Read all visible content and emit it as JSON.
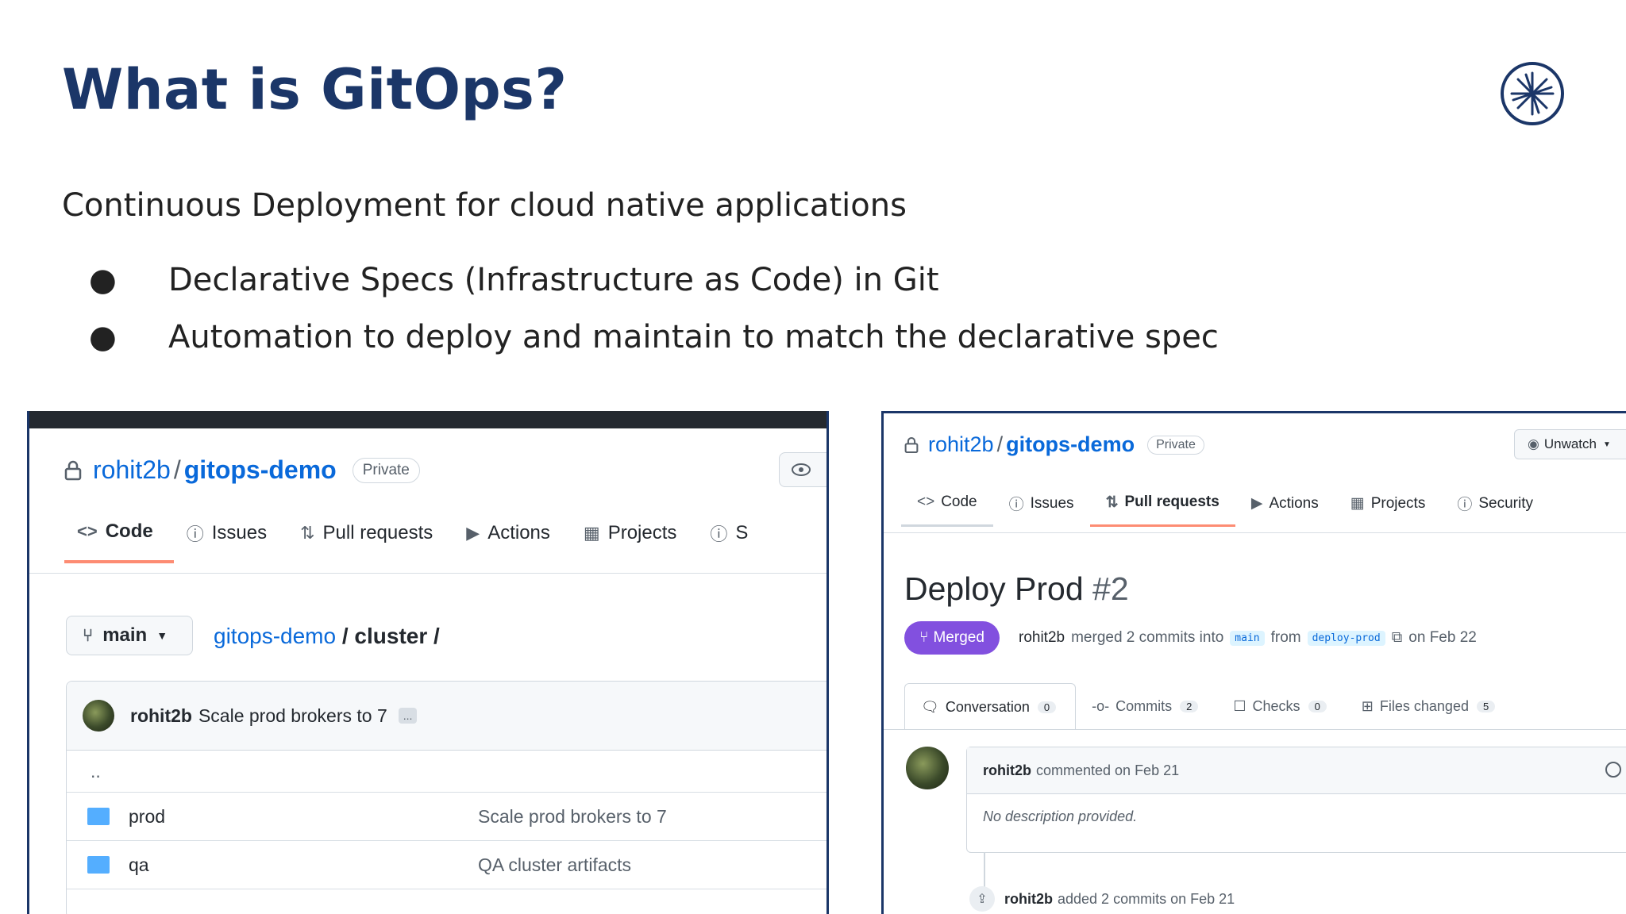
{
  "slide": {
    "title": "What is GitOps?",
    "subtitle": "Continuous Deployment for cloud native applications",
    "bullets": [
      "Declarative Specs (Infrastructure as Code) in Git",
      "Automation to deploy and maintain to match the declarative spec"
    ],
    "bullet_glyph": "●",
    "logo_icon": "cncf-asterisk-icon"
  },
  "left_repo": {
    "owner": "rohit2b",
    "separator": "/",
    "repo": "gitops-demo",
    "visibility": "Private",
    "tabs": [
      {
        "icon": "<>",
        "label": "Code"
      },
      {
        "icon": "ⓘ",
        "label": "Issues"
      },
      {
        "icon": "⇅",
        "label": "Pull requests"
      },
      {
        "icon": "▶",
        "label": "Actions"
      },
      {
        "icon": "▦",
        "label": "Projects"
      },
      {
        "icon": "ⓘ",
        "label": "S"
      }
    ],
    "branch": "main",
    "path_repo": "gitops-demo",
    "path_dir": "/ cluster /",
    "latest_commit": {
      "author": "rohit2b",
      "message": "Scale prod brokers to 7",
      "more": "..."
    },
    "parent_dir": "..",
    "files": [
      {
        "name": "prod",
        "message": "Scale prod brokers to 7"
      },
      {
        "name": "qa",
        "message": "QA cluster artifacts"
      }
    ]
  },
  "right_pr": {
    "owner": "rohit2b",
    "separator": "/",
    "repo": "gitops-demo",
    "visibility": "Private",
    "unwatch_label": "Unwatch",
    "tabs": [
      {
        "icon": "<>",
        "label": "Code"
      },
      {
        "icon": "ⓘ",
        "label": "Issues"
      },
      {
        "icon": "⇅",
        "label": "Pull requests"
      },
      {
        "icon": "▶",
        "label": "Actions"
      },
      {
        "icon": "▦",
        "label": "Projects"
      },
      {
        "icon": "ⓘ",
        "label": "Security"
      }
    ],
    "title": "Deploy Prod",
    "number": "#2",
    "status": "Merged",
    "merge_author": "rohit2b",
    "merge_text": "merged 2 commits into",
    "base_branch": "main",
    "from_text": "from",
    "head_branch": "deploy-prod",
    "merge_date": "on Feb 22",
    "pr_tabs": [
      {
        "label": "Conversation",
        "count": "0"
      },
      {
        "label": "Commits",
        "count": "2"
      },
      {
        "label": "Checks",
        "count": "0"
      },
      {
        "label": "Files changed",
        "count": "5"
      }
    ],
    "comment": {
      "author": "rohit2b",
      "meta": "commented on Feb 21",
      "body": "No description provided."
    },
    "timeline": {
      "author": "rohit2b",
      "text": "added 2 commits on Feb 21"
    }
  }
}
